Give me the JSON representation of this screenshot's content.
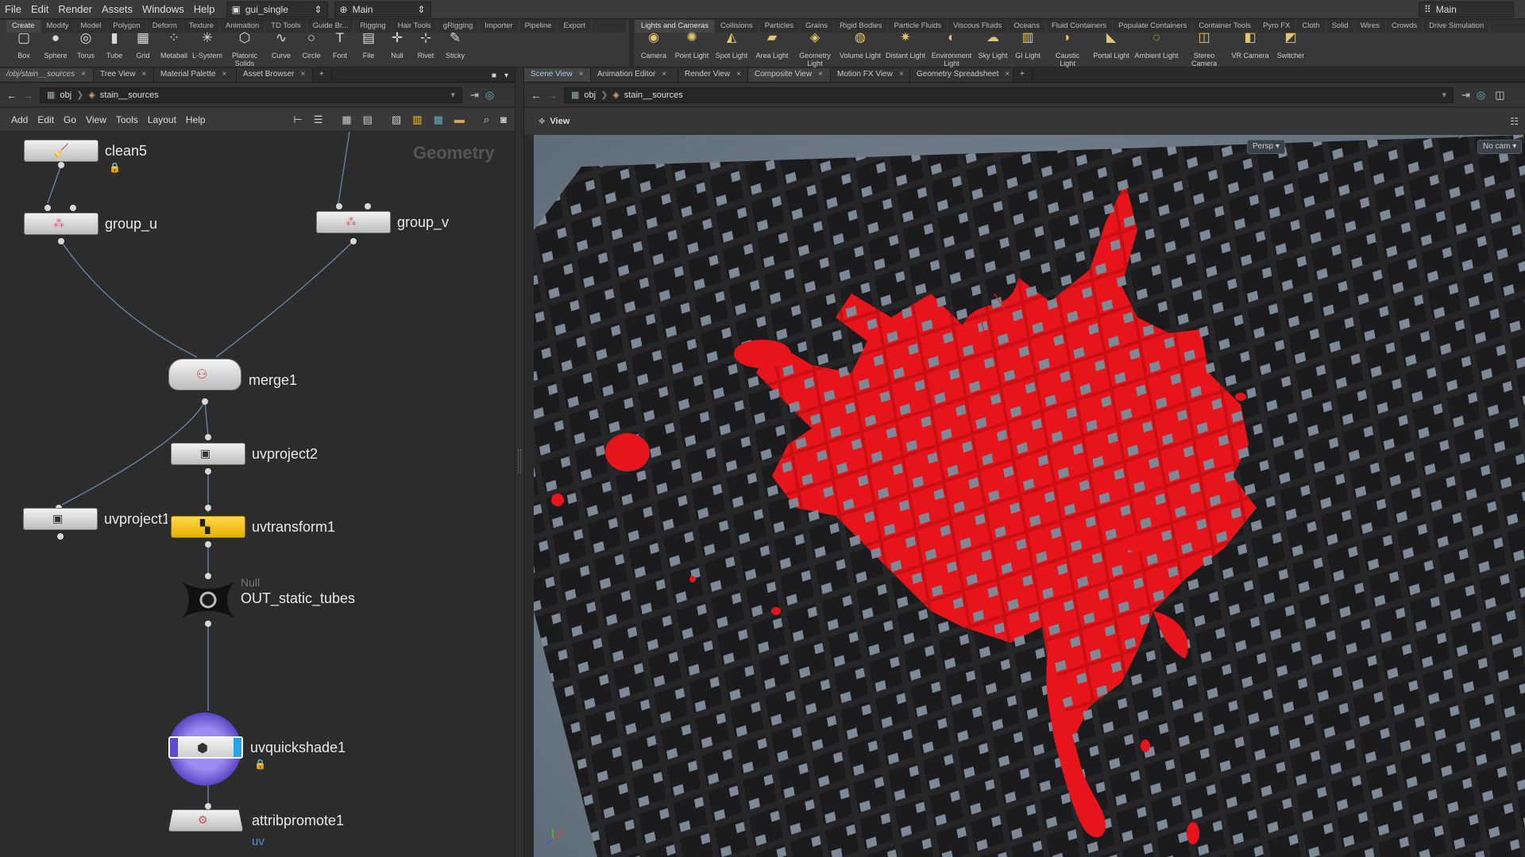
{
  "menubar": {
    "items": [
      "File",
      "Edit",
      "Render",
      "Assets",
      "Windows",
      "Help"
    ],
    "desktop_select": "gui_single",
    "context_select": "Main",
    "right_select": "Main"
  },
  "shelf": {
    "left_tabs": [
      "Create",
      "Modify",
      "Model",
      "Polygon",
      "Deform",
      "Texture",
      "Animation",
      "TD Tools",
      "Guide Br...",
      "Rigging",
      "Hair Tools",
      "gRigging",
      "Importer",
      "Pipeline",
      "Export"
    ],
    "left_tools": [
      "Box",
      "Sphere",
      "Torus",
      "Tube",
      "Grid",
      "Metaball",
      "L-System",
      "Platonic Solids",
      "Curve",
      "Circle",
      "Font",
      "File",
      "Null",
      "Rivet",
      "Sticky"
    ],
    "right_tabs": [
      "Lights and Cameras",
      "Collisions",
      "Particles",
      "Grains",
      "Rigid Bodies",
      "Particle Fluids",
      "Viscous Fluids",
      "Oceans",
      "Fluid Containers",
      "Populate Containers",
      "Container Tools",
      "Pyro FX",
      "Cloth",
      "Solid",
      "Wires",
      "Crowds",
      "Drive Simulation"
    ],
    "right_tools": [
      "Camera",
      "Point Light",
      "Spot Light",
      "Area Light",
      "Geometry Light",
      "Volume Light",
      "Distant Light",
      "Environment Light",
      "Sky Light",
      "GI Light",
      "Caustic Light",
      "Portal Light",
      "Ambient Light",
      "Stereo Camera",
      "VR Camera",
      "Switcher"
    ]
  },
  "left_pane": {
    "tabs": [
      "/obj/stain__sources",
      "Tree View",
      "Material Palette",
      "Asset Browser"
    ],
    "path_root": "obj",
    "path_node": "stain__sources",
    "menu": [
      "Add",
      "Edit",
      "Go",
      "View",
      "Tools",
      "Layout",
      "Help"
    ],
    "context_label": "Geometry",
    "nodes": {
      "clean5": "clean5",
      "group_u": "group_u",
      "group_v": "group_v",
      "merge1": "merge1",
      "uvproject2": "uvproject2",
      "uvproject1": "uvproject1",
      "uvtransform1": "uvtransform1",
      "null_type": "Null",
      "out": "OUT_static_tubes",
      "uvquickshade1": "uvquickshade1",
      "attribpromote1": "attribpromote1",
      "attribpromote_sub": "uv"
    }
  },
  "right_pane": {
    "tabs": [
      "Scene View",
      "Animation Editor",
      "Render View",
      "Composite View",
      "Motion FX View",
      "Geometry Spreadsheet"
    ],
    "path_root": "obj",
    "path_node": "stain__sources",
    "view_label": "View",
    "persp": "Persp ▾",
    "cam": "No cam ▾"
  },
  "colors": {
    "stain": "#e8141b",
    "cloth": "#1c1c1e",
    "bg": "#6e7b87",
    "selected_node": "#f2c319",
    "display_ring": "#6a5bd8"
  }
}
